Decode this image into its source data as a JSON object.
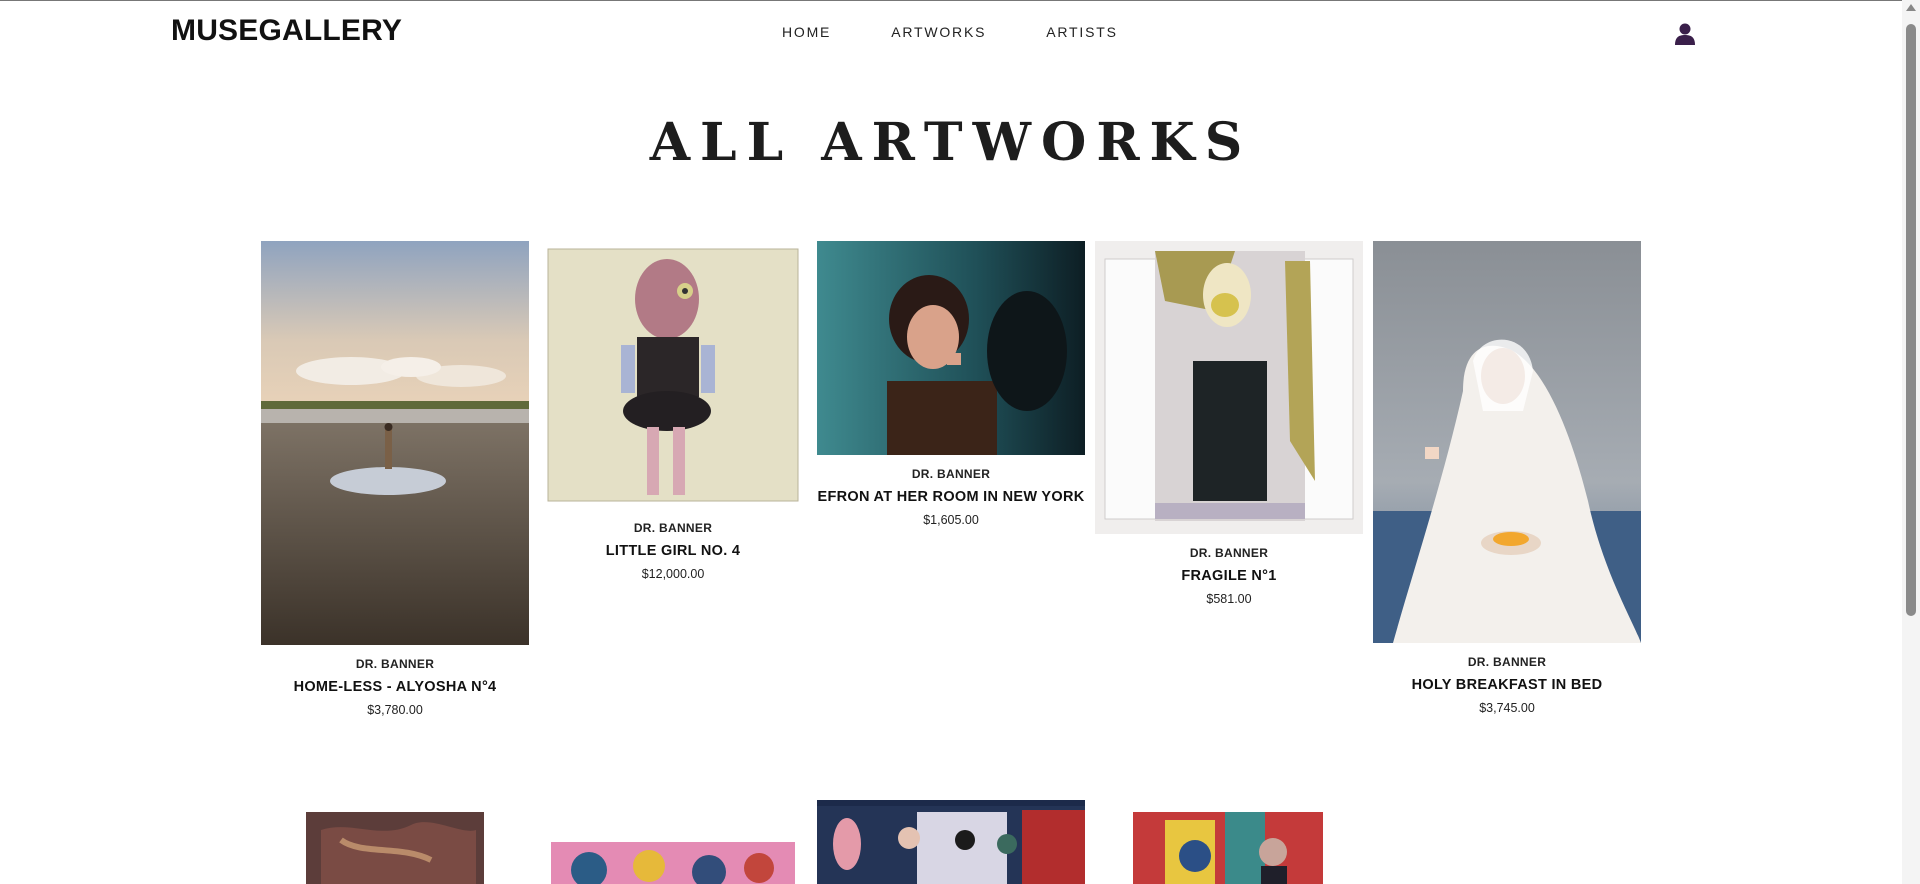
{
  "header": {
    "logo": "MUSEGALLERY",
    "nav": [
      {
        "label": "HOME"
      },
      {
        "label": "ARTWORKS"
      },
      {
        "label": "ARTISTS"
      }
    ],
    "user_icon": "user-icon"
  },
  "main": {
    "title": "ALL ARTWORKS",
    "artworks": [
      {
        "artist": "DR. BANNER",
        "title": "HOME-LESS - ALYOSHA N°4",
        "price": "$3,780.00"
      },
      {
        "artist": "DR. BANNER",
        "title": "LITTLE GIRL NO. 4",
        "price": "$12,000.00"
      },
      {
        "artist": "DR. BANNER",
        "title": "EFRON AT HER ROOM IN NEW YORK",
        "price": "$1,605.00"
      },
      {
        "artist": "DR. BANNER",
        "title": "FRAGILE N°1",
        "price": "$581.00"
      },
      {
        "artist": "DR. BANNER",
        "title": "HOLY BREAKFAST IN BED",
        "price": "$3,745.00"
      }
    ]
  },
  "colors": {
    "accent": "#3a1f4a",
    "text": "#111111"
  }
}
